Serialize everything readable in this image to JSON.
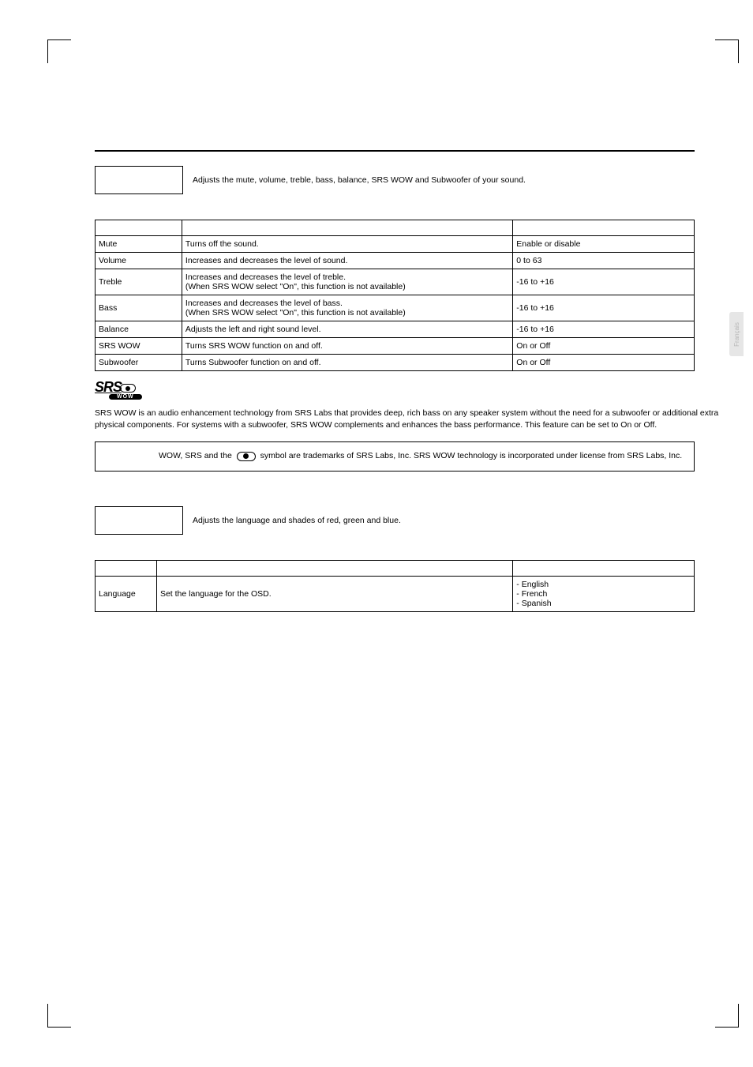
{
  "side_tab": "Français",
  "audio_section": {
    "description": "Adjusts the mute, volume, treble, bass, balance, SRS WOW and Subwoofer of your sound.",
    "rows": [
      {
        "option": "Mute",
        "function": "Turns off the sound.",
        "value": "Enable or disable"
      },
      {
        "option": "Volume",
        "function": "Increases and decreases the level of sound.",
        "value": "0 to 63"
      },
      {
        "option": "Treble",
        "function": "Increases and decreases the level of treble.\n(When SRS WOW select \"On\", this function is not available)",
        "value": "-16 to +16"
      },
      {
        "option": "Bass",
        "function": "Increases and decreases the level of bass.\n(When SRS WOW select \"On\", this function is not available)",
        "value": "-16 to +16"
      },
      {
        "option": "Balance",
        "function": "Adjusts the left and right sound level.",
        "value": "-16 to +16"
      },
      {
        "option": "SRS WOW",
        "function": "Turns SRS WOW function on and off.",
        "value": "On or Off"
      },
      {
        "option": "Subwoofer",
        "function": "Turns Subwoofer function on and off.",
        "value": "On or Off"
      }
    ]
  },
  "srs": {
    "logo_text": "SRS",
    "badge": "WOW",
    "description": "SRS WOW is an audio enhancement technology from SRS Labs that provides deep, rich bass on any speaker system without the need for a subwoofer or additional extra physical components. For systems with a subwoofer, SRS WOW complements and enhances the bass performance. This feature can be set to On or Off.",
    "trademark_before": "WOW, SRS and the ",
    "trademark_after": " symbol are trademarks of SRS Labs, Inc. SRS WOW technology is incorporated under license from SRS Labs, Inc."
  },
  "setup_section": {
    "description": "Adjusts the language and shades of red, green and blue.",
    "rows": [
      {
        "option": "Language",
        "function": "Set the language for the OSD.",
        "value": "- English\n- French\n- Spanish"
      }
    ]
  }
}
